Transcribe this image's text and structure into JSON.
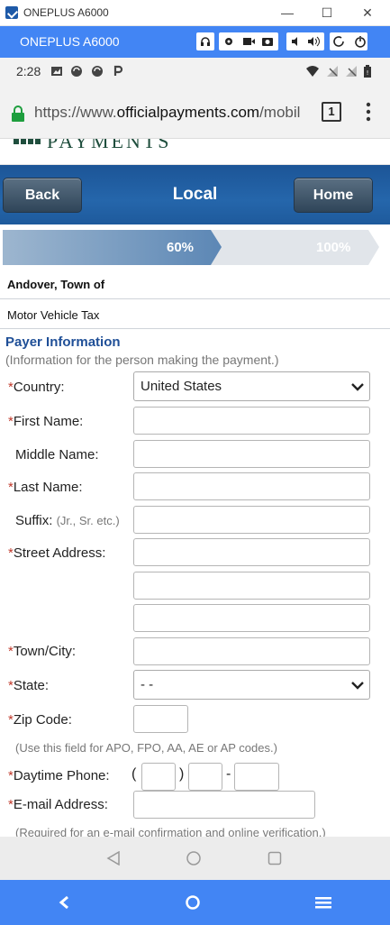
{
  "window": {
    "title": "ONEPLUS A6000",
    "minimize": "—",
    "maximize": "☐",
    "close": "✕"
  },
  "emulator": {
    "device_name": "ONEPLUS A6000"
  },
  "status_bar": {
    "time": "2:28"
  },
  "browser": {
    "url_scheme": "https://www.",
    "url_domain": "officialpayments.com",
    "url_rest": "/mobil",
    "tab_count": "1"
  },
  "site": {
    "logo_text": "PAYMENTS",
    "nav": {
      "back_label": "Back",
      "title": "Local",
      "home_label": "Home"
    },
    "progress": {
      "current_label": "60%",
      "end_label": "100%",
      "fill_fraction": 0.6
    },
    "merchant": "Andover, Town of",
    "payment_type": "Motor Vehicle Tax"
  },
  "form": {
    "section_title": "Payer Information",
    "section_subtitle": "(Information for the person making the payment.)",
    "required_marker": "*",
    "country_label": "Country:",
    "country_value": "United States",
    "first_name_label": "First Name:",
    "middle_name_label": "Middle Name:",
    "last_name_label": "Last Name:",
    "suffix_label": "Suffix:",
    "suffix_hint": "(Jr., Sr. etc.)",
    "street_label": "Street Address:",
    "town_label": "Town/City:",
    "state_label": "State:",
    "state_value": "- -",
    "zip_label": "Zip Code:",
    "zip_note": "(Use this field for APO, FPO, AA, AE or AP codes.)",
    "phone_label": "Daytime Phone:",
    "phone_open": "(",
    "phone_close": ")",
    "phone_dash": "-",
    "email_label": "E-mail Address:",
    "email_note": "(Required for an e-mail confirmation and online verification.)"
  },
  "colors": {
    "emulator_blue": "#4285f4",
    "site_nav_blue": "#1f5a9e",
    "section_title": "#1f4f97",
    "required": "#c0392b"
  }
}
